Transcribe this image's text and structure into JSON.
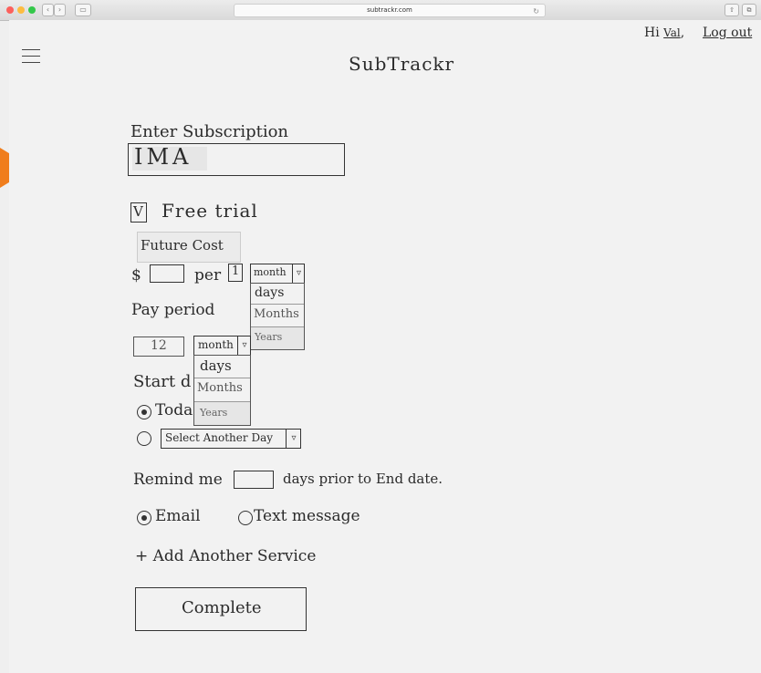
{
  "browser": {
    "url": "subtrackr.com"
  },
  "header": {
    "greeting": "Hi",
    "user": "Val",
    "separator": ",",
    "logout_label": "Log out",
    "app_title": "SubTrackr"
  },
  "form": {
    "subscription_label": "Enter Subscription",
    "subscription_value": "IMA",
    "free_trial_check": "V",
    "free_trial_label": "Free trial",
    "future_cost_label": "Future Cost",
    "currency": "$",
    "per_label": "per",
    "per_number": "1",
    "per_unit_selected": "month",
    "per_unit_options": [
      "days",
      "Months",
      "Years"
    ],
    "pay_period_label": "Pay period",
    "pay_period_value": "12",
    "pay_period_unit": "month",
    "pay_period_options": [
      "days",
      "Months",
      "Years"
    ],
    "start_date_label": "Start d",
    "today_label": "Toda",
    "select_day_label": "Select Another Day",
    "remind_prefix": "Remind me",
    "remind_suffix": "days prior to End date.",
    "email_label": "Email",
    "text_label": "Text message",
    "add_service_label": "+ Add Another Service",
    "complete_label": "Complete"
  },
  "icons": {
    "menu": "hamburger-icon",
    "dropdown": "triangle-down-icon"
  },
  "colors": {
    "pointer": "#f07d1c"
  }
}
